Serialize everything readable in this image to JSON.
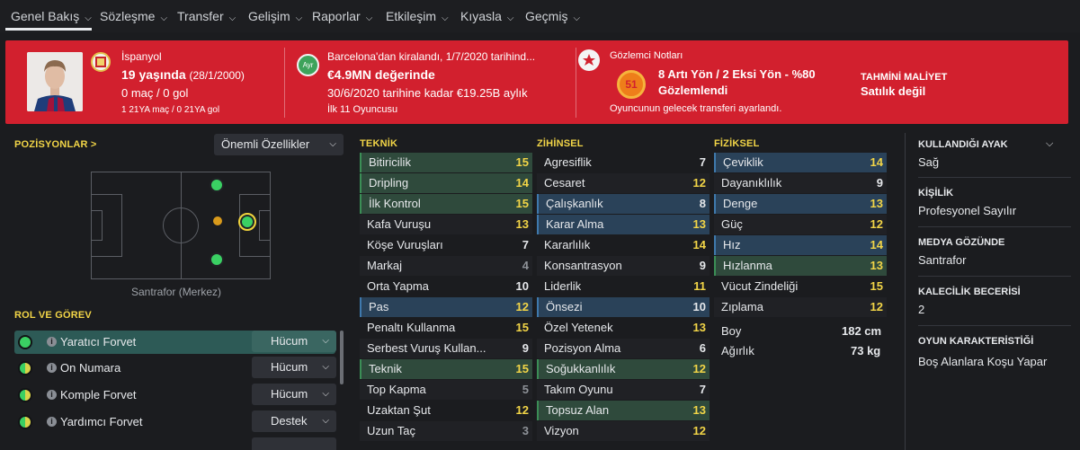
{
  "nav": {
    "tabs": [
      {
        "label": "Genel Bakış"
      },
      {
        "label": "Sözleşme"
      },
      {
        "label": "Transfer"
      },
      {
        "label": "Gelişim"
      },
      {
        "label": "Raporlar"
      },
      {
        "label": "Etkileşim"
      },
      {
        "label": "Kıyasla"
      },
      {
        "label": "Geçmiş"
      }
    ]
  },
  "header": {
    "club": "İspanyol",
    "age_main": "19 yaşında",
    "age_dob": "(28/1/2000)",
    "apps": "0 maç / 0 gol",
    "youth_apps": "1 21YA maç / 0 21YA gol",
    "loan_text": "Barcelona'dan kiralandı, 1/7/2020 tarihind...",
    "value": "€4.9MN değerinde",
    "wage": "30/6/2020 tarihine kadar €19.25B aylık",
    "squad": "İlk 11 Oyuncusu",
    "loan_badge": "Ayr",
    "scout_title": "Gözlemci Notları",
    "scout_score": "51",
    "scout_line1": "8 Artı Yön / 2 Eksi Yön - %80",
    "scout_line2": "Gözlemlendi",
    "scout_note": "Oyuncunun gelecek transferi ayarlandı.",
    "cost_label": "TAHMİNİ MALİYET",
    "cost_value": "Satılık değil"
  },
  "left": {
    "positions_title": "POZİSYONLAR",
    "positions_arrow": ">",
    "attr_dropdown": "Önemli Özellikler",
    "position_label": "Santrafor (Merkez)",
    "role_title": "ROL VE GÖREV",
    "roles": [
      {
        "name": "Yaratıcı Forvet",
        "duty": "Hücum"
      },
      {
        "name": "On Numara",
        "duty": "Hücum"
      },
      {
        "name": "Komple Forvet",
        "duty": "Hücum"
      },
      {
        "name": "Yardımcı Forvet",
        "duty": "Destek"
      }
    ]
  },
  "attributes": {
    "technical": {
      "title": "TEKNİK",
      "items": [
        {
          "name": "Bitiricilik",
          "value": "15",
          "hl": "green"
        },
        {
          "name": "Dripling",
          "value": "14",
          "hl": "green"
        },
        {
          "name": "İlk Kontrol",
          "value": "15",
          "hl": "green"
        },
        {
          "name": "Kafa Vuruşu",
          "value": "13",
          "hl": ""
        },
        {
          "name": "Köşe Vuruşları",
          "value": "7",
          "hl": ""
        },
        {
          "name": "Markaj",
          "value": "4",
          "hl": ""
        },
        {
          "name": "Orta Yapma",
          "value": "10",
          "hl": ""
        },
        {
          "name": "Pas",
          "value": "12",
          "hl": "blue"
        },
        {
          "name": "Penaltı Kullanma",
          "value": "15",
          "hl": ""
        },
        {
          "name": "Serbest Vuruş Kullan...",
          "value": "9",
          "hl": ""
        },
        {
          "name": "Teknik",
          "value": "15",
          "hl": "green"
        },
        {
          "name": "Top Kapma",
          "value": "5",
          "hl": ""
        },
        {
          "name": "Uzaktan Şut",
          "value": "12",
          "hl": ""
        },
        {
          "name": "Uzun Taç",
          "value": "3",
          "hl": ""
        }
      ]
    },
    "mental": {
      "title": "ZİHİNSEL",
      "items": [
        {
          "name": "Agresiflik",
          "value": "7",
          "hl": ""
        },
        {
          "name": "Cesaret",
          "value": "12",
          "hl": ""
        },
        {
          "name": "Çalışkanlık",
          "value": "8",
          "hl": "blue"
        },
        {
          "name": "Karar Alma",
          "value": "13",
          "hl": "blue"
        },
        {
          "name": "Kararlılık",
          "value": "14",
          "hl": ""
        },
        {
          "name": "Konsantrasyon",
          "value": "9",
          "hl": ""
        },
        {
          "name": "Liderlik",
          "value": "11",
          "hl": ""
        },
        {
          "name": "Önsezi",
          "value": "10",
          "hl": "blue"
        },
        {
          "name": "Özel Yetenek",
          "value": "13",
          "hl": ""
        },
        {
          "name": "Pozisyon Alma",
          "value": "6",
          "hl": ""
        },
        {
          "name": "Soğukkanlılık",
          "value": "12",
          "hl": "green"
        },
        {
          "name": "Takım Oyunu",
          "value": "7",
          "hl": ""
        },
        {
          "name": "Topsuz Alan",
          "value": "13",
          "hl": "green"
        },
        {
          "name": "Vizyon",
          "value": "12",
          "hl": ""
        }
      ]
    },
    "physical": {
      "title": "FİZİKSEL",
      "items": [
        {
          "name": "Çeviklik",
          "value": "14",
          "hl": "blue"
        },
        {
          "name": "Dayanıklılık",
          "value": "9",
          "hl": ""
        },
        {
          "name": "Denge",
          "value": "13",
          "hl": "blue"
        },
        {
          "name": "Güç",
          "value": "12",
          "hl": ""
        },
        {
          "name": "Hız",
          "value": "14",
          "hl": "blue"
        },
        {
          "name": "Hızlanma",
          "value": "13",
          "hl": "green"
        },
        {
          "name": "Vücut Zindeliği",
          "value": "15",
          "hl": ""
        },
        {
          "name": "Zıplama",
          "value": "12",
          "hl": ""
        }
      ],
      "height_label": "Boy",
      "height_value": "182 cm",
      "weight_label": "Ağırlık",
      "weight_value": "73 kg"
    }
  },
  "info": {
    "foot_label": "KULLANDIĞI AYAK",
    "foot_value": "Sağ",
    "personality_label": "KİŞİLİK",
    "personality_value": "Profesyonel Sayılır",
    "media_label": "MEDYA GÖZÜNDE",
    "media_value": "Santrafor",
    "gk_label": "KALECİLİK BECERİSİ",
    "gk_value": "2",
    "char_label": "OYUN KARAKTERİSTİĞİ",
    "char_value": "Boş Alanlara Koşu Yapar"
  },
  "colors": {
    "accent_red": "#d2202e",
    "yellow_value": "#f2d547",
    "green_row": "#2f4a3c",
    "blue_row": "#2a4259"
  }
}
